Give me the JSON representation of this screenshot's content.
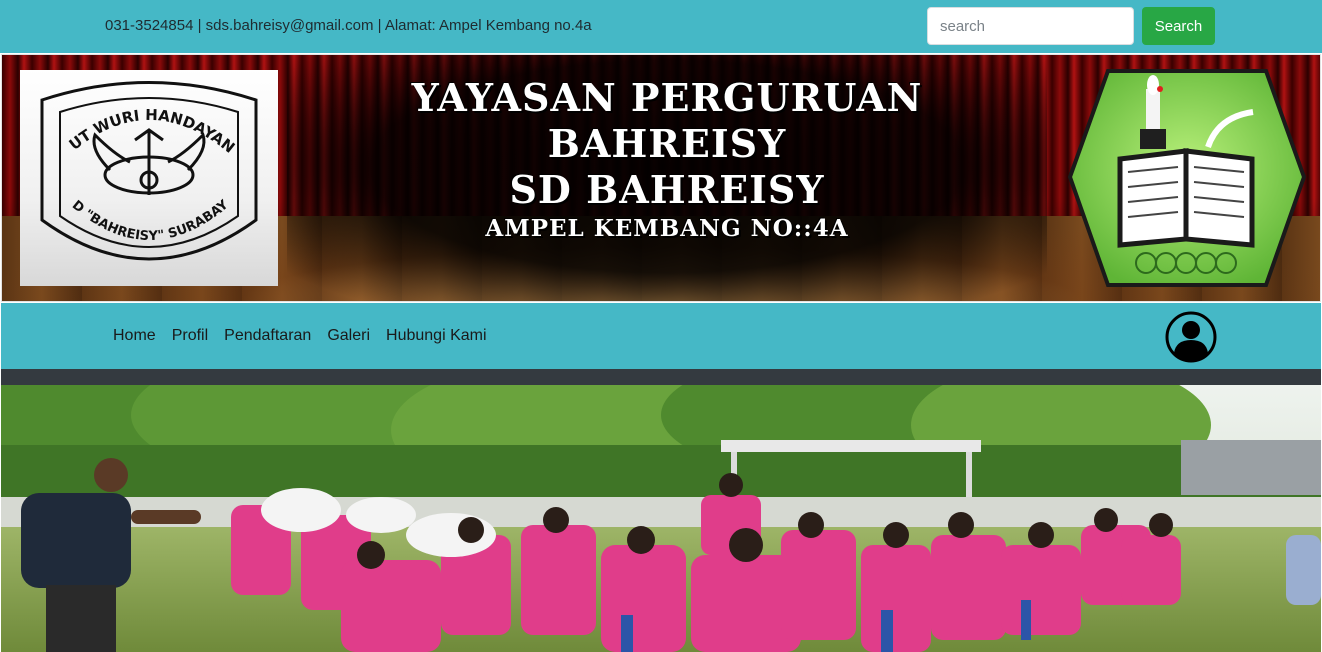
{
  "topbar": {
    "contact": "031-3524854 | sds.bahreisy@gmail.com | Alamat: Ampel Kembang no.4a",
    "search_placeholder": "search",
    "search_button": "Search"
  },
  "banner": {
    "line1": "YAYASAN PERGURUAN",
    "line2": "BAHREISY",
    "line3": "SD BAHREISY",
    "line4": "AMPEL KEMBANG NO::4A",
    "left_logo_text_top": "TUT WURI HANDAYANI",
    "left_logo_text_bottom": "SD \"BAHREISY\" SURABAYA"
  },
  "nav": {
    "items": [
      "Home",
      "Profil",
      "Pendaftaran",
      "Galeri",
      "Hubungi Kami"
    ],
    "avatar_icon": "user-circle-icon"
  },
  "colors": {
    "teal": "#45b8c6",
    "green_button": "#28a745",
    "dark_strip": "#343a40"
  }
}
